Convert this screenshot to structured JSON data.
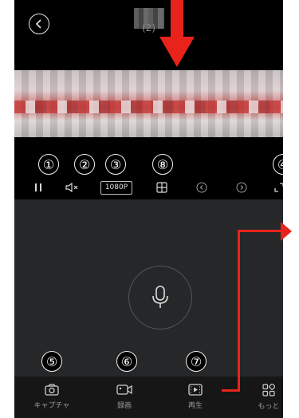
{
  "header": {
    "title": "(2)"
  },
  "controls": {
    "resolution": "1080P"
  },
  "callouts": [
    "①",
    "②",
    "③",
    "⑧",
    "④",
    "⑤",
    "⑥",
    "⑦"
  ],
  "bottom_nav": [
    {
      "label": "キャプチャ",
      "icon": "camera-icon"
    },
    {
      "label": "録画",
      "icon": "video-record-icon"
    },
    {
      "label": "再生",
      "icon": "playback-icon"
    },
    {
      "label": "もっと",
      "icon": "more-grid-icon"
    }
  ],
  "colors": {
    "accent_red": "#e8231c",
    "background": "#222324"
  }
}
